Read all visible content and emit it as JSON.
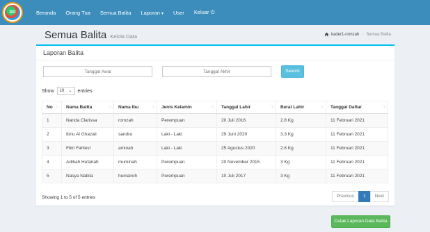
{
  "nav": {
    "logo_text": "DG",
    "items": [
      "Beranda",
      "Orang Tua",
      "Semua Balita",
      "Laporan",
      "User",
      "Keluar"
    ],
    "laporan_caret": "▾",
    "logout_icon": "⏻"
  },
  "header": {
    "title": "Semua Balita",
    "subtitle": "Kelola Data"
  },
  "breadcrumb": {
    "user": "kader1-romzah",
    "current": "Semua Balita"
  },
  "box": {
    "title": "Laporan Balita"
  },
  "filter": {
    "start_placeholder": "Tanggal Awal",
    "end_placeholder": "Tanggal Akhir",
    "search_label": "Search"
  },
  "length": {
    "show": "Show",
    "value": "10",
    "entries": "entries"
  },
  "table": {
    "headers": [
      "No",
      "Nama Balita",
      "Nama Ibu",
      "Jenis Kelamin",
      "Tanggal Lahir",
      "Berat Lahir",
      "Tanggal Daftar"
    ],
    "rows": [
      [
        "1",
        "Nanda Clarissa",
        "romzah",
        "Perempuan",
        "20 Juli 2016",
        "2.8 Kg",
        "11 Februari 2021"
      ],
      [
        "2",
        "Ibnu Al Ghazali",
        "sandra",
        "Laki - Laki",
        "29 Juni 2020",
        "3.3 Kg",
        "11 Februari 2021"
      ],
      [
        "3",
        "Fikri Fahlevi",
        "aminah",
        "Laki - Laki",
        "25 Agustus 2020",
        "2.6 Kg",
        "11 Februari 2021"
      ],
      [
        "4",
        "Adibah Hufairah",
        "muminah",
        "Perempuan",
        "20 November 2015",
        "3 Kg",
        "11 Februari 2021"
      ],
      [
        "5",
        "Nasya Nabila",
        "humairoh",
        "Perempuan",
        "10 Juli 2017",
        "3 Kg",
        "11 Februari 2021"
      ]
    ]
  },
  "info": "Showing 1 to 5 of 5 entries",
  "pagination": {
    "previous": "Previous",
    "page": "1",
    "next": "Next"
  },
  "print_button": "Cetak Laporan Data Balita",
  "colors": {
    "navbar": "#3c8dbc",
    "box_accent": "#00c0ef",
    "search": "#5bc0de",
    "print": "#5cb85c",
    "page_active": "#337ab7"
  }
}
